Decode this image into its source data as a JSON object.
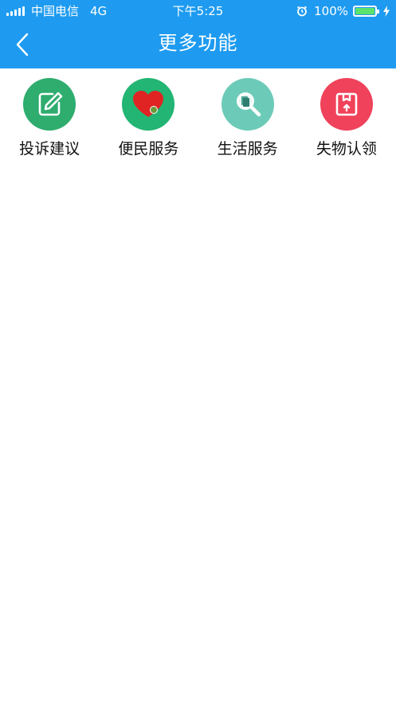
{
  "status_bar": {
    "carrier": "中国电信",
    "network": "4G",
    "time": "下午5:25",
    "battery": "100%",
    "battery_level": 1.0,
    "icons": [
      "signal-icon",
      "alarm-icon",
      "battery-icon",
      "charging-icon"
    ]
  },
  "nav": {
    "title": "更多功能",
    "back_icon": "back-chevron-icon"
  },
  "features": [
    {
      "label": "投诉建议",
      "icon": "edit-icon",
      "color": "#2EAD6E"
    },
    {
      "label": "便民服务",
      "icon": "heart-icon",
      "color": "#22B573"
    },
    {
      "label": "生活服务",
      "icon": "search-document-icon",
      "color": "#6CCBB8"
    },
    {
      "label": "失物认领",
      "icon": "box-icon",
      "color": "#F0425B"
    }
  ],
  "colors": {
    "header": "#1E9BF0",
    "background": "#FFFFFF"
  }
}
